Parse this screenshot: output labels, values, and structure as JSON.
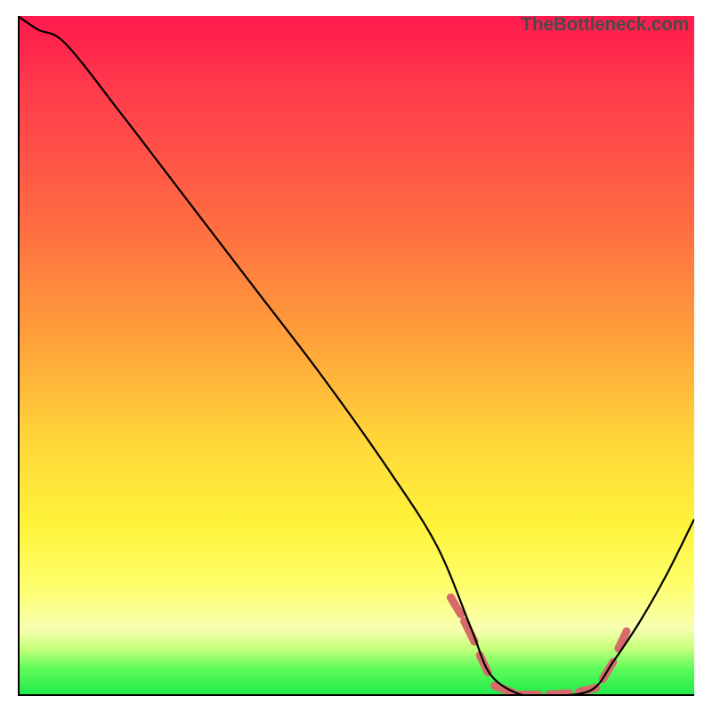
{
  "watermark": "TheBottleneck.com",
  "colors": {
    "gradient_top": "#ff1a4d",
    "gradient_mid": "#ffd53a",
    "gradient_bottom": "#1fe84a",
    "curve": "#000000",
    "dash": "#d86a6c",
    "axis": "#000000"
  },
  "chart_data": {
    "type": "line",
    "title": "",
    "xlabel": "",
    "ylabel": "",
    "xlim": [
      0,
      100
    ],
    "ylim": [
      0,
      100
    ],
    "grid": false,
    "curve_description": "Bottleneck-style curve: starts near 100% at x=0, descends steeply and near-linearly to a broad flat minimum (~0) spanning roughly x=67 to x=85, then rises again toward the right edge.",
    "x": [
      0,
      3,
      7,
      15,
      25,
      35,
      45,
      55,
      62,
      67,
      70,
      75,
      80,
      85,
      88,
      92,
      96,
      100
    ],
    "y": [
      100,
      98,
      96,
      86,
      73,
      60,
      47,
      33,
      22,
      10,
      3,
      0,
      0,
      1,
      5,
      11,
      18,
      26
    ],
    "flat_zone_dash": {
      "color": "#d86a6c",
      "segments": [
        {
          "x0": 64.0,
          "y0": 14.5,
          "x1": 65.5,
          "y1": 12.0
        },
        {
          "x0": 66.0,
          "y0": 11.0,
          "x1": 67.5,
          "y1": 8.0
        },
        {
          "x0": 68.3,
          "y0": 6.0,
          "x1": 69.5,
          "y1": 3.5
        },
        {
          "x0": 70.5,
          "y0": 1.5,
          "x1": 73.2,
          "y1": 0.5
        },
        {
          "x0": 74.0,
          "y0": 0.2,
          "x1": 77.0,
          "y1": 0.2
        },
        {
          "x0": 78.5,
          "y0": 0.2,
          "x1": 81.5,
          "y1": 0.4
        },
        {
          "x0": 83.0,
          "y0": 0.6,
          "x1": 85.5,
          "y1": 1.2
        },
        {
          "x0": 86.5,
          "y0": 2.5,
          "x1": 88.0,
          "y1": 5.0
        },
        {
          "x0": 88.8,
          "y0": 7.0,
          "x1": 90.0,
          "y1": 9.5
        }
      ]
    }
  }
}
